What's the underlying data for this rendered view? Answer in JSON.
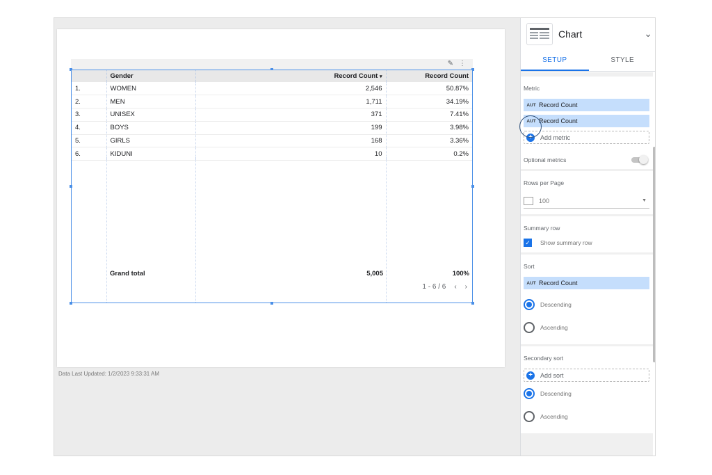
{
  "report": {
    "last_updated": "Data Last Updated: 1/2/2023 9:33:31 AM"
  },
  "table": {
    "headers": [
      "Gender",
      "Record Count",
      "Record Count"
    ],
    "sort_indicator": "▾",
    "rows": [
      {
        "idx": "1.",
        "gender": "WOMEN",
        "count": "2,546",
        "pct": "50.87%"
      },
      {
        "idx": "2.",
        "gender": "MEN",
        "count": "1,711",
        "pct": "34.19%"
      },
      {
        "idx": "3.",
        "gender": "UNISEX",
        "count": "371",
        "pct": "7.41%"
      },
      {
        "idx": "4.",
        "gender": "BOYS",
        "count": "199",
        "pct": "3.98%"
      },
      {
        "idx": "5.",
        "gender": "GIRLS",
        "count": "168",
        "pct": "3.36%"
      },
      {
        "idx": "6.",
        "gender": "KIDUNI",
        "count": "10",
        "pct": "0.2%"
      }
    ],
    "grand_total_label": "Grand total",
    "grand_total_count": "5,005",
    "grand_total_pct": "100%",
    "pagination": "1 - 6 / 6",
    "prev_icon": "chevron-left-icon",
    "next_icon": "chevron-right-icon"
  },
  "panel": {
    "title": "Chart",
    "tabs": [
      "SETUP",
      "STYLE"
    ],
    "metric": {
      "title": "Metric",
      "chips": [
        {
          "tag": "AUT",
          "label": "Record Count"
        },
        {
          "tag": "AUT",
          "label": "Record Count"
        }
      ],
      "add_label": "Add metric"
    },
    "optional_metrics": "Optional metrics",
    "rows_per_page": {
      "title": "Rows per Page",
      "value": "100"
    },
    "summary_row": {
      "title": "Summary row",
      "checkbox_label": "Show summary row"
    },
    "sort": {
      "title": "Sort",
      "chip": {
        "tag": "AUT",
        "label": "Record Count"
      },
      "descending": "Descending",
      "ascending": "Ascending"
    },
    "secondary_sort": {
      "title": "Secondary sort",
      "add_label": "Add sort",
      "descending": "Descending",
      "ascending": "Ascending"
    }
  },
  "colors": {
    "accent": "#1a73e8",
    "chip": "#c5defc",
    "selection": "#4a8fe7"
  }
}
